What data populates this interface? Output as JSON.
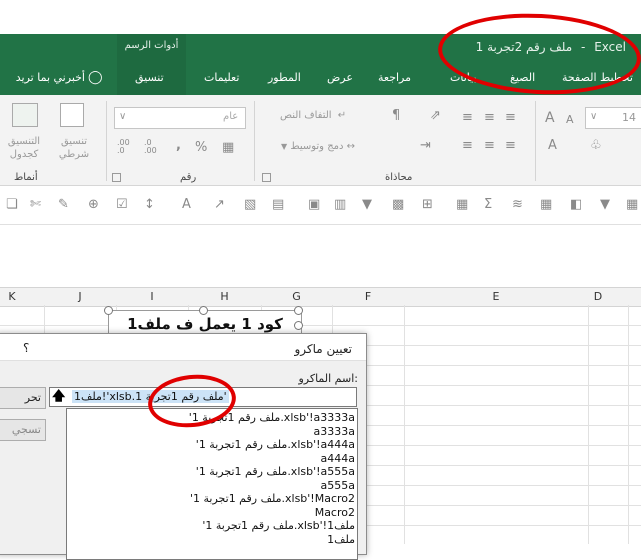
{
  "window": {
    "title_doc": "ملف رقم 2تجربة 1",
    "title_sep": "-",
    "title_app": "Excel",
    "title_color": "#217346"
  },
  "ribbon": {
    "context_group": "أدوات الرسم",
    "tabs": [
      "تخطيط الصفحة",
      "الصيغ",
      "بيانات",
      "مراجعة",
      "عرض",
      "المطور",
      "تعليمات",
      "تنسيق"
    ],
    "active_tab": "تنسيق",
    "tell_me": "أخبرني بما تريد",
    "groups": {
      "font": {
        "size": "14",
        "grow_icon": "A",
        "shrink_icon": "A"
      },
      "alignment": {
        "label": "محاذاة",
        "wrap_text": "التفاف النص",
        "merge_center": "دمج وتوسيط"
      },
      "number": {
        "label": "رقم",
        "format": "عام",
        "percent": "%",
        "comma": ",",
        "inc_decimal": ".00 .0",
        "dec_decimal": ".0 .00"
      },
      "styles": {
        "label": "أنماط",
        "conditional_line1": "تنسيق",
        "conditional_line2": "شرطي",
        "table_line1": "التنسيق",
        "table_line2": "كجدول"
      }
    }
  },
  "sheet": {
    "columns": [
      "D",
      "E",
      "F",
      "G",
      "H",
      "I",
      "J",
      "K"
    ],
    "shape_text": "كود 1 يعمل ف ملف1"
  },
  "dialog": {
    "title": "تعيين ماكرو",
    "help": "؟",
    "macro_name_label": "اسم الماكرو:",
    "macro_name_value": "'ملف رقم 1تجربة 1.xlsb'!ملف1",
    "side_button_1": "تحر",
    "side_button_2": "تسجي",
    "macros": [
      "'ملف رقم 1تجربة 1.xlsb'!a3333a",
      "a3333a",
      "'ملف رقم 1تجربة 1.xlsb'!a444a",
      "a444a",
      "'ملف رقم 1تجربة 1.xlsb'!a555a",
      "a555a",
      "'ملف رقم 1تجربة 1.xlsb'!Macro2",
      "Macro2",
      "'ملف رقم 1تجربة 1.xlsb'!ملف1",
      "ملف1"
    ]
  },
  "annotation_color": "#e00000"
}
